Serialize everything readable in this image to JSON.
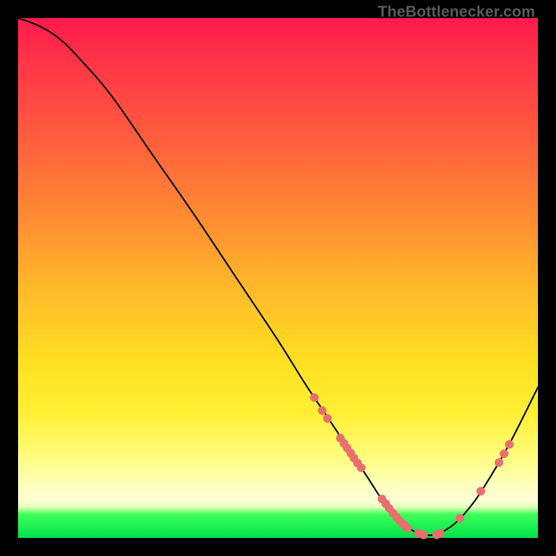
{
  "watermark": "TheBottlenecker.com",
  "chart_data": {
    "type": "line",
    "title": "",
    "xlabel": "",
    "ylabel": "",
    "xlim": [
      0,
      100
    ],
    "ylim": [
      0,
      100
    ],
    "series": [
      {
        "name": "curve",
        "x": [
          0,
          4,
          8,
          12,
          18,
          26,
          34,
          42,
          50,
          55,
          59,
          63,
          67,
          71,
          75,
          79,
          83,
          87,
          91,
          95,
          100
        ],
        "y": [
          100,
          98.5,
          96,
          92,
          85,
          73.5,
          62,
          50,
          38,
          30,
          24,
          18,
          12,
          6,
          2,
          0.5,
          2,
          6,
          12,
          19,
          29
        ]
      }
    ],
    "markers": [
      {
        "x": 57.0,
        "y": 27.0
      },
      {
        "x": 58.5,
        "y": 24.5
      },
      {
        "x": 59.5,
        "y": 23.0
      },
      {
        "x": 62.0,
        "y": 19.2
      },
      {
        "x": 62.7,
        "y": 18.2
      },
      {
        "x": 63.3,
        "y": 17.3
      },
      {
        "x": 64.0,
        "y": 16.3
      },
      {
        "x": 64.6,
        "y": 15.4
      },
      {
        "x": 65.3,
        "y": 14.4
      },
      {
        "x": 66.0,
        "y": 13.5
      },
      {
        "x": 70.0,
        "y": 7.5
      },
      {
        "x": 70.7,
        "y": 6.6
      },
      {
        "x": 71.4,
        "y": 5.7
      },
      {
        "x": 72.1,
        "y": 4.8
      },
      {
        "x": 72.8,
        "y": 4.0
      },
      {
        "x": 73.5,
        "y": 3.2
      },
      {
        "x": 74.2,
        "y": 2.5
      },
      {
        "x": 74.9,
        "y": 1.9
      },
      {
        "x": 77.0,
        "y": 0.9
      },
      {
        "x": 78.0,
        "y": 0.6
      },
      {
        "x": 80.5,
        "y": 0.6
      },
      {
        "x": 81.2,
        "y": 0.9
      },
      {
        "x": 85.0,
        "y": 3.8
      },
      {
        "x": 89.0,
        "y": 9.0
      },
      {
        "x": 92.5,
        "y": 14.5
      },
      {
        "x": 93.5,
        "y": 16.2
      },
      {
        "x": 94.5,
        "y": 18.0
      }
    ],
    "marker_color": "#e96f6f",
    "curve_color": "#000000"
  }
}
